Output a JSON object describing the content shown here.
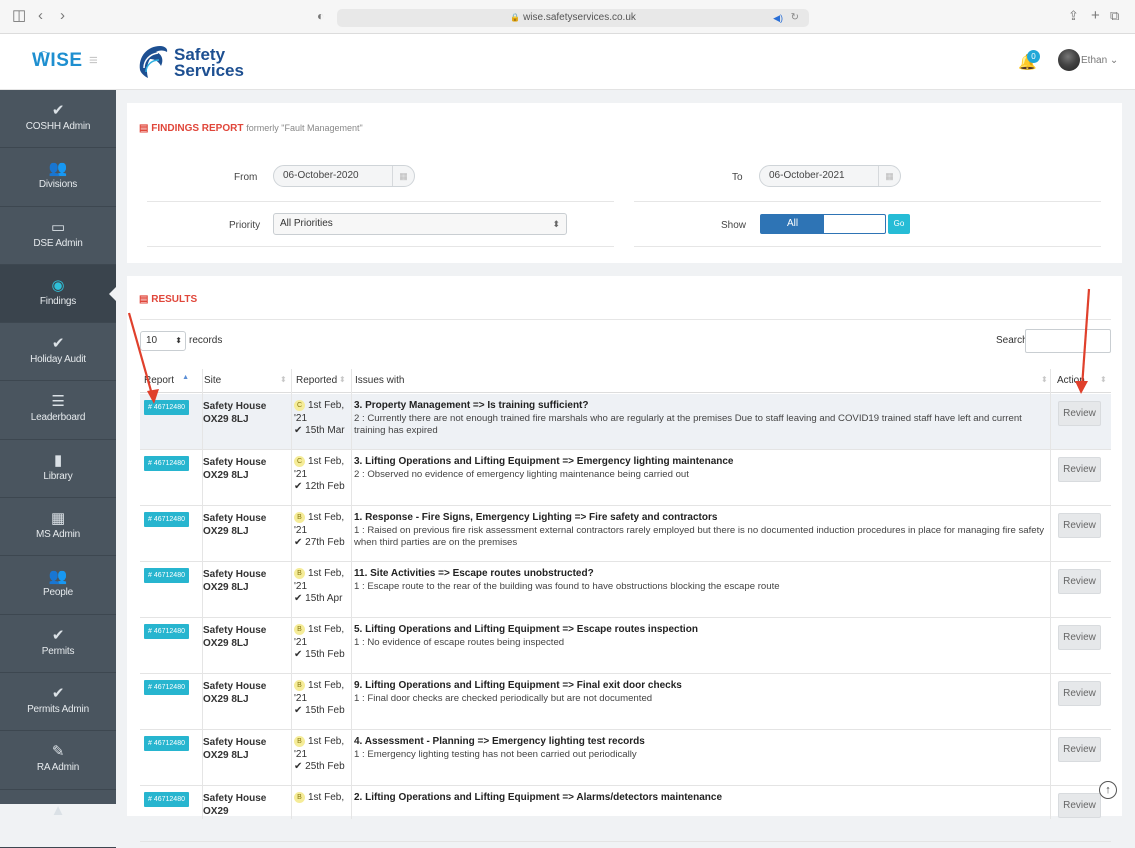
{
  "browser": {
    "url": "wise.safetyservices.co.uk"
  },
  "brand": {
    "app_name": "WISE",
    "company_line1": "Safety",
    "company_line2": "Services"
  },
  "sidebar": {
    "items": [
      {
        "label": "COSHH Admin",
        "icon": "check-icon"
      },
      {
        "label": "Divisions",
        "icon": "group-icon"
      },
      {
        "label": "DSE Admin",
        "icon": "monitor-icon"
      },
      {
        "label": "Findings",
        "icon": "eye-icon",
        "active": true
      },
      {
        "label": "Holiday Audit",
        "icon": "check-icon"
      },
      {
        "label": "Leaderboard",
        "icon": "list-icon"
      },
      {
        "label": "Library",
        "icon": "book-icon"
      },
      {
        "label": "MS Admin",
        "icon": "calendar-icon"
      },
      {
        "label": "People",
        "icon": "group-icon"
      },
      {
        "label": "Permits",
        "icon": "check-icon"
      },
      {
        "label": "Permits Admin",
        "icon": "check-icon"
      },
      {
        "label": "RA Admin",
        "icon": "pencil-icon"
      }
    ]
  },
  "header": {
    "notification_count": "0",
    "user_name": "Ethan ⌄"
  },
  "filters": {
    "title": "FINDINGS REPORT",
    "subtitle": "formerly \"Fault Management\"",
    "from_label": "From",
    "from_value": "06-October-2020",
    "to_label": "To",
    "to_value": "06-October-2021",
    "priority_label": "Priority",
    "priority_value": "All Priorities",
    "show_label": "Show",
    "show_value": "All",
    "go_label": "Go"
  },
  "results": {
    "title": "RESULTS",
    "page_length": "10",
    "records_label": "records",
    "search_label": "Search:",
    "columns": [
      "Report",
      "Site",
      "Reported",
      "Issues with",
      "Action"
    ],
    "rows": [
      {
        "report": "# 46712480",
        "site": "Safety House OX29 8LJ",
        "priority": "C",
        "reported": "1st Feb, '21",
        "done": "✔ 15th Mar",
        "title": "3. Property Management => Is training sufficient?",
        "detail": "2 : Currently there are not enough trained fire marshals who are regularly at the premises Due to staff leaving and COVID19 trained staff have left and current training has expired",
        "action": "Review"
      },
      {
        "report": "# 46712480",
        "site": "Safety House OX29 8LJ",
        "priority": "C",
        "reported": "1st Feb, '21",
        "done": "✔ 12th Feb",
        "title": "3. Lifting Operations and Lifting Equipment => Emergency lighting maintenance",
        "detail": "2 : Observed no evidence of emergency lighting maintenance being carried out",
        "action": "Review"
      },
      {
        "report": "# 46712480",
        "site": "Safety House OX29 8LJ",
        "priority": "B",
        "reported": "1st Feb, '21",
        "done": "✔ 27th Feb",
        "title": "1. Response - Fire Signs, Emergency Lighting => Fire safety and contractors",
        "detail": "1 : Raised on previous fire risk assessment external contractors rarely employed but there is no documented induction procedures in place for managing fire safety when third parties are on the premises",
        "action": "Review"
      },
      {
        "report": "# 46712480",
        "site": "Safety House OX29 8LJ",
        "priority": "B",
        "reported": "1st Feb, '21",
        "done": "✔ 15th Apr",
        "title": "11. Site Activities => Escape routes unobstructed?",
        "detail": "1 : Escape route to the rear of the building was found to have obstructions blocking the escape route",
        "action": "Review"
      },
      {
        "report": "# 46712480",
        "site": "Safety House OX29 8LJ",
        "priority": "B",
        "reported": "1st Feb, '21",
        "done": "✔ 15th Feb",
        "title": "5. Lifting Operations and Lifting Equipment => Escape routes inspection",
        "detail": "1 : No evidence of escape routes being inspected",
        "action": "Review"
      },
      {
        "report": "# 46712480",
        "site": "Safety House OX29 8LJ",
        "priority": "B",
        "reported": "1st Feb, '21",
        "done": "✔ 15th Feb",
        "title": "9. Lifting Operations and Lifting Equipment => Final exit door checks",
        "detail": "1 : Final door checks are checked periodically but are not documented",
        "action": "Review"
      },
      {
        "report": "# 46712480",
        "site": "Safety House OX29 8LJ",
        "priority": "B",
        "reported": "1st Feb, '21",
        "done": "✔ 25th Feb",
        "title": "4. Assessment - Planning => Emergency lighting test records",
        "detail": "1 : Emergency lighting testing has not been carried out periodically",
        "action": "Review"
      },
      {
        "report": "# 46712480",
        "site": "Safety House OX29",
        "priority": "B",
        "reported": "1st Feb,",
        "done": "",
        "title": "2. Lifting Operations and Lifting Equipment => Alarms/detectors maintenance",
        "detail": "",
        "action": "Review"
      }
    ]
  },
  "colors": {
    "accent": "#27b5cf",
    "sidebar": "#4a555f",
    "alert": "#e0463a",
    "brand": "#1d4f91"
  }
}
